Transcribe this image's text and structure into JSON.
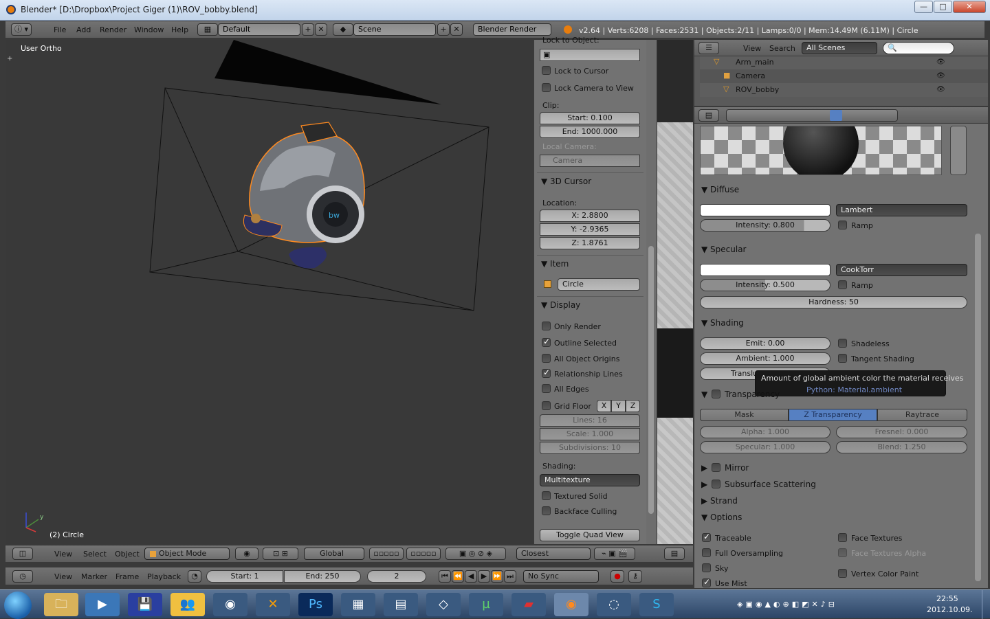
{
  "window": {
    "title": "Blender* [D:\\Dropbox\\Project Giger (1)\\ROV_bobby.blend]",
    "minimize": "—",
    "maximize": "□",
    "close": "✕"
  },
  "info_header": {
    "menus": [
      "File",
      "Add",
      "Render",
      "Window",
      "Help"
    ],
    "layout": "Default",
    "scene": "Scene",
    "engine": "Blender Render",
    "stats": "v2.64 | Verts:6208 | Faces:2531 | Objects:2/11 | Lamps:0/0 | Mem:14.49M (6.11M) | Circle"
  },
  "viewport": {
    "view_label": "User Ortho",
    "object_label": "(2) Circle",
    "axis_y": "y"
  },
  "npanel": {
    "lock_to_object_label": "Lock to Object:",
    "lock_to_cursor": "Lock to Cursor",
    "lock_camera_to_view": "Lock Camera to View",
    "clip_label": "Clip:",
    "clip_start": "Start: 0.100",
    "clip_end": "End: 1000.000",
    "local_camera_label": "Local Camera:",
    "local_camera_value": "Camera",
    "cursor_header": "3D Cursor",
    "location_label": "Location:",
    "loc_x": "X: 2.8800",
    "loc_y": "Y: -2.9365",
    "loc_z": "Z: 1.8761",
    "item_header": "Item",
    "item_name": "Circle",
    "display_header": "Display",
    "only_render": "Only Render",
    "outline_selected": "Outline Selected",
    "all_object_origins": "All Object Origins",
    "relationship_lines": "Relationship Lines",
    "all_edges": "All Edges",
    "grid_floor": "Grid Floor",
    "axis_x": "X",
    "axis_y": "Y",
    "axis_z": "Z",
    "lines": "Lines: 16",
    "scale": "Scale: 1.000",
    "subdivisions": "Subdivisions: 10",
    "shading_label": "Shading:",
    "shading_value": "Multitexture",
    "textured_solid": "Textured Solid",
    "backface_culling": "Backface Culling",
    "toggle_quad_view": "Toggle Quad View"
  },
  "outliner": {
    "view": "View",
    "search": "Search",
    "scenes": "All Scenes",
    "items": [
      "Arm_main",
      "Camera",
      "ROV_bobby"
    ]
  },
  "properties": {
    "diffuse_header": "Diffuse",
    "diffuse_shader": "Lambert",
    "diffuse_intensity": "Intensity: 0.800",
    "ramp": "Ramp",
    "specular_header": "Specular",
    "specular_shader": "CookTorr",
    "specular_intensity": "Intensity: 0.500",
    "hardness": "Hardness: 50",
    "shading_header": "Shading",
    "emit": "Emit: 0.00",
    "shadeless": "Shadeless",
    "ambient": "Ambient: 1.000",
    "tangent_shading": "Tangent Shading",
    "translucency": "Translu",
    "tooltip_text": "Amount of global ambient color the material receives",
    "tooltip_python": "Python: Material.ambient",
    "transparency_header": "Transparency",
    "tab_mask": "Mask",
    "tab_z": "Z Transparency",
    "tab_ray": "Raytrace",
    "alpha": "Alpha: 1.000",
    "fresnel": "Fresnel: 0.000",
    "specular": "Specular: 1.000",
    "blend": "Blend: 1.250",
    "mirror_header": "Mirror",
    "sss_header": "Subsurface Scattering",
    "strand_header": "Strand",
    "options_header": "Options",
    "traceable": "Traceable",
    "face_textures": "Face Textures",
    "full_oversampling": "Full Oversampling",
    "face_textures_alpha": "Face Textures Alpha",
    "sky": "Sky",
    "vertex_color_paint": "Vertex Color Paint",
    "use_mist": "Use Mist"
  },
  "view3d_header": {
    "menus": [
      "View",
      "Select",
      "Object"
    ],
    "mode": "Object Mode",
    "orientation": "Global",
    "snap": "Closest"
  },
  "timeline": {
    "menus": [
      "View",
      "Marker",
      "Frame",
      "Playback"
    ],
    "start": "Start: 1",
    "end": "End: 250",
    "current": "2",
    "sync": "No Sync"
  },
  "taskbar": {
    "time": "22:55",
    "date": "2012.10.09."
  },
  "colors": {
    "selection_outline": "#ff8a1f",
    "tab_active": "#5680c2",
    "bg_viewport": "#393939"
  }
}
